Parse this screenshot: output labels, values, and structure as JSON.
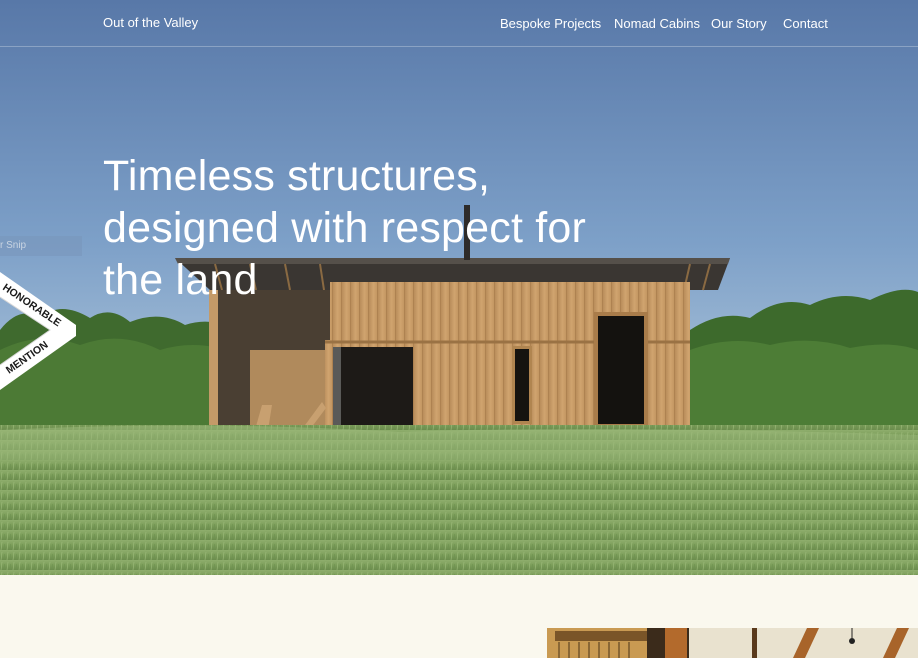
{
  "header": {
    "brand": "Out of the Valley",
    "nav": [
      {
        "label": "Bespoke Projects"
      },
      {
        "label": "Nomad Cabins"
      },
      {
        "label": "Our Story"
      },
      {
        "label": "Contact"
      }
    ]
  },
  "hero": {
    "headline": "Timeless structures, designed with respect for the land",
    "snip_tab": "r Snip"
  },
  "award": {
    "line1": "HONORABLE",
    "line2": "MENTION"
  },
  "colors": {
    "sky_top": "#5c7fae",
    "sky_bottom": "#a9c3db",
    "grass": "#7ea35e",
    "cabin_wood": "#c79a64",
    "background_cream": "#faf8ee"
  }
}
